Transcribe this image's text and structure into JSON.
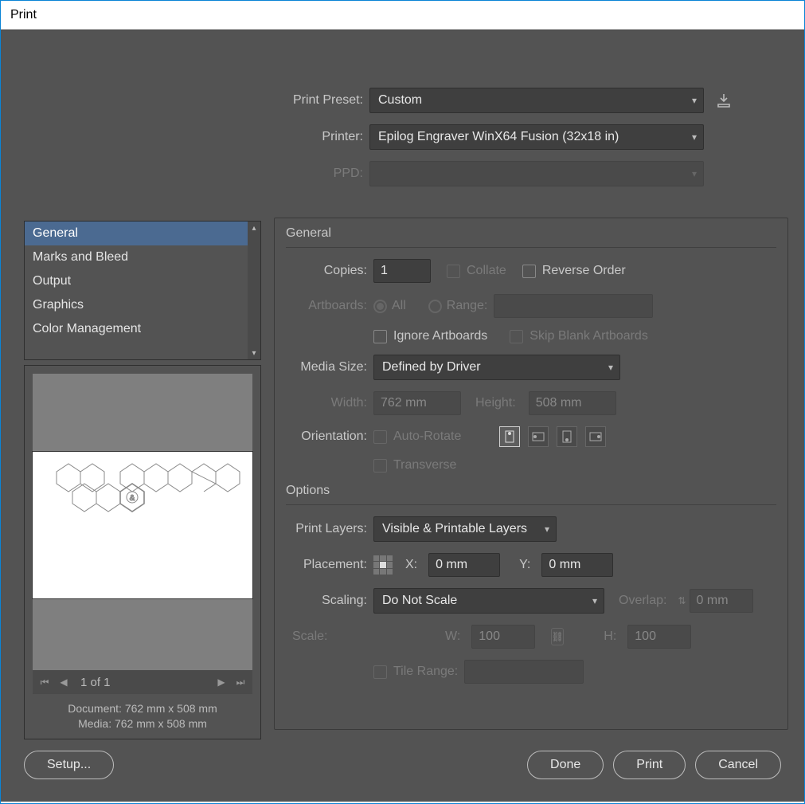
{
  "window": {
    "title": "Print"
  },
  "top": {
    "preset_label": "Print Preset:",
    "preset_value": "Custom",
    "printer_label": "Printer:",
    "printer_value": "Epilog Engraver WinX64 Fusion (32x18 in)",
    "ppd_label": "PPD:",
    "ppd_value": ""
  },
  "sidebar": {
    "items": [
      "General",
      "Marks and Bleed",
      "Output",
      "Graphics",
      "Color Management"
    ],
    "selected_index": 0
  },
  "preview": {
    "pager_text": "1 of 1",
    "doc_line": "Document: 762 mm x 508 mm",
    "media_line": "Media: 762 mm x 508 mm"
  },
  "general": {
    "title": "General",
    "copies_label": "Copies:",
    "copies_value": "1",
    "collate_label": "Collate",
    "reverse_label": "Reverse Order",
    "artboards_label": "Artboards:",
    "all_label": "All",
    "range_label": "Range:",
    "range_value": "",
    "ignore_label": "Ignore Artboards",
    "skip_label": "Skip Blank Artboards",
    "media_label": "Media Size:",
    "media_value": "Defined by Driver",
    "width_label": "Width:",
    "width_value": "762 mm",
    "height_label": "Height:",
    "height_value": "508 mm",
    "orient_label": "Orientation:",
    "autorotate_label": "Auto-Rotate",
    "transverse_label": "Transverse"
  },
  "options": {
    "title": "Options",
    "layers_label": "Print Layers:",
    "layers_value": "Visible & Printable Layers",
    "placement_label": "Placement:",
    "x_label": "X:",
    "x_value": "0 mm",
    "y_label": "Y:",
    "y_value": "0 mm",
    "scaling_label": "Scaling:",
    "scaling_value": "Do Not Scale",
    "overlap_label": "Overlap:",
    "overlap_value": "0 mm",
    "scale_label": "Scale:",
    "w_label": "W:",
    "w_value": "100",
    "h_label": "H:",
    "h_value": "100",
    "tile_label": "Tile Range:",
    "tile_value": ""
  },
  "buttons": {
    "setup": "Setup...",
    "done": "Done",
    "print": "Print",
    "cancel": "Cancel"
  }
}
